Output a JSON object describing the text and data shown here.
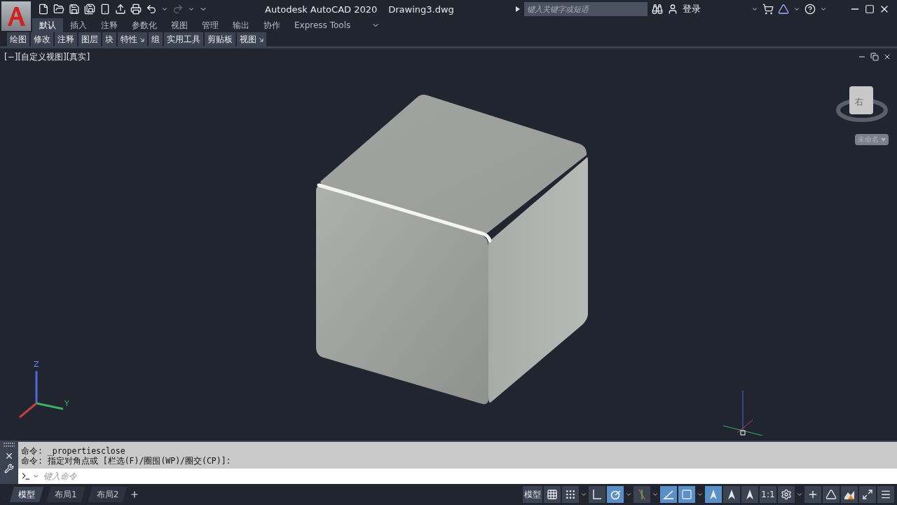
{
  "title_bar": {
    "title": "Autodesk AutoCAD 2020",
    "document": "Drawing3.dwg",
    "search": {
      "placeholder": "键入关键字或短语"
    },
    "sign_in": "登录"
  },
  "ribbon_tabs": [
    {
      "label": "默认",
      "selected": true
    },
    {
      "label": "插入",
      "selected": false
    },
    {
      "label": "注释",
      "selected": false
    },
    {
      "label": "参数化",
      "selected": false
    },
    {
      "label": "视图",
      "selected": false
    },
    {
      "label": "管理",
      "selected": false
    },
    {
      "label": "输出",
      "selected": false
    },
    {
      "label": "协作",
      "selected": false
    },
    {
      "label": "Express Tools",
      "selected": false
    }
  ],
  "ribbon_panels": [
    {
      "label": "绘图",
      "launcher": false
    },
    {
      "label": "修改",
      "launcher": false
    },
    {
      "label": "注释",
      "launcher": false
    },
    {
      "label": "图层",
      "launcher": false
    },
    {
      "label": "块",
      "launcher": false
    },
    {
      "label": "特性",
      "launcher": true
    },
    {
      "label": "组",
      "launcher": false
    },
    {
      "label": "实用工具",
      "launcher": false
    },
    {
      "label": "剪贴板",
      "launcher": false
    },
    {
      "label": "视图",
      "launcher": true
    }
  ],
  "viewport": {
    "label": "[−][自定义视图][真实]",
    "viewcube": {
      "face": "右",
      "named_view": "未命名"
    },
    "ucs": {
      "z": "Z",
      "y": "Y"
    }
  },
  "command_line": {
    "history": [
      "命令: _propertiesclose",
      "命令: 指定对角点或 [栏选(F)/圈围(WP)/圈交(CP)]:"
    ],
    "placeholder": "键入命令"
  },
  "layout_tabs": [
    {
      "label": "模型",
      "selected": true
    },
    {
      "label": "布局1",
      "selected": false
    },
    {
      "label": "布局2",
      "selected": false
    }
  ],
  "status_items": [
    {
      "kind": "text",
      "label": "模型"
    },
    {
      "kind": "grid",
      "on": false,
      "dropdown": false
    },
    {
      "kind": "snap",
      "on": false,
      "dropdown": true
    },
    {
      "kind": "ortho",
      "on": false,
      "dropdown": false
    },
    {
      "kind": "polar",
      "on": true,
      "dropdown": true
    },
    {
      "kind": "iso",
      "on": false,
      "dropdown": true
    },
    {
      "kind": "track",
      "on": true,
      "dropdown": false
    },
    {
      "kind": "osnap",
      "on": true,
      "dropdown": true
    },
    {
      "kind": "annotate",
      "on": true,
      "dropdown": false
    },
    {
      "kind": "autoscale",
      "on": false,
      "dropdown": false
    },
    {
      "kind": "visibility",
      "on": false,
      "dropdown": false
    },
    {
      "kind": "text",
      "label": "1:1"
    },
    {
      "kind": "gear",
      "on": false,
      "dropdown": true
    },
    {
      "kind": "plus",
      "on": false,
      "dropdown": false
    },
    {
      "kind": "isolate",
      "on": false,
      "dropdown": false
    },
    {
      "kind": "hardware",
      "on": false,
      "dropdown": false
    },
    {
      "kind": "fullscreen",
      "on": false,
      "dropdown": false
    },
    {
      "kind": "menu",
      "on": false,
      "dropdown": false
    }
  ]
}
